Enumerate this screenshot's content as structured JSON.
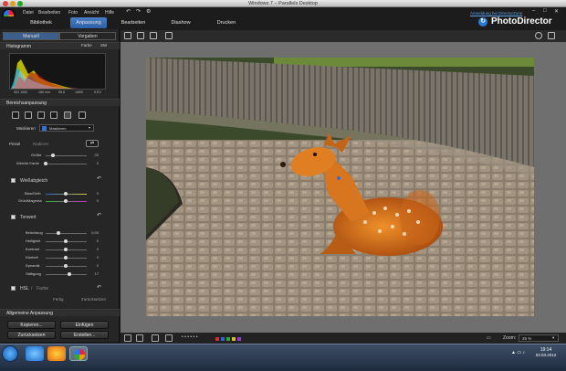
{
  "window": {
    "title": "Windows 7 – Parallels Desktop"
  },
  "app_menu": [
    "Datei",
    "Bearbeiten",
    "Foto",
    "Ansicht",
    "Hilfe"
  ],
  "register_link": "Anmeldung bei DirectorZone",
  "brand": "PhotoDirector",
  "modes": [
    {
      "label": "Bibliothek",
      "active": false
    },
    {
      "label": "Anpassung",
      "active": true
    },
    {
      "label": "Bearbeiten",
      "active": false
    },
    {
      "label": "Diashow",
      "active": false
    },
    {
      "label": "Drucken",
      "active": false
    }
  ],
  "panel": {
    "tabs": [
      {
        "label": "Manuell",
        "active": true
      },
      {
        "label": "Vorgaben",
        "active": false
      }
    ],
    "histogram": {
      "title": "Histogramm",
      "mode_color": "Farbe",
      "mode_bw": "SW",
      "labels": [
        "ISO 1000",
        "160 mm",
        "f/5.6",
        "1/800",
        "0 EV"
      ]
    },
    "regional": {
      "title": "Bereichsanpassung",
      "mask_label": "Maskieren",
      "mask_value": "Maskieren",
      "brush_label": "Pinsel",
      "eraser_label": "Radierer",
      "size_label": "Größe",
      "size_value": "20",
      "feather_label": "Weiche Kante",
      "feather_value": "0"
    },
    "wb": {
      "title": "Weißabgleich",
      "sliders": [
        {
          "label": "Blau/Gelb",
          "value": "0"
        },
        {
          "label": "Grün/Magenta",
          "value": "0"
        }
      ]
    },
    "tone": {
      "title": "Tonwert",
      "sliders": [
        {
          "label": "Belichtung",
          "value": "0,00"
        },
        {
          "label": "Helligkeit",
          "value": "0"
        },
        {
          "label": "Kontrast",
          "value": "0"
        },
        {
          "label": "Klarheit",
          "value": "0"
        },
        {
          "label": "Dynamik",
          "value": "0"
        },
        {
          "label": "Sättigung",
          "value": "17"
        }
      ]
    },
    "hsl": {
      "title": "HSL",
      "sep": "/",
      "sub": "Farbe",
      "done": "Fertig",
      "reset": "Zurücksetzen"
    },
    "global": {
      "title": "Allgemeine Anpassung"
    },
    "buttons": {
      "copy": "Kopieren...",
      "paste": "Einfügen",
      "reset": "Zurücksetzen",
      "create": "Erstellen..."
    }
  },
  "bottombar": {
    "zoom_label": "Zoom:",
    "zoom_value": "25 %"
  },
  "taskbar": {
    "time": "19:14",
    "date": "03.03.2012"
  },
  "colors": {
    "accent": "#3d6cb3",
    "panel": "#262626",
    "canvas": "#6f6f6f"
  }
}
